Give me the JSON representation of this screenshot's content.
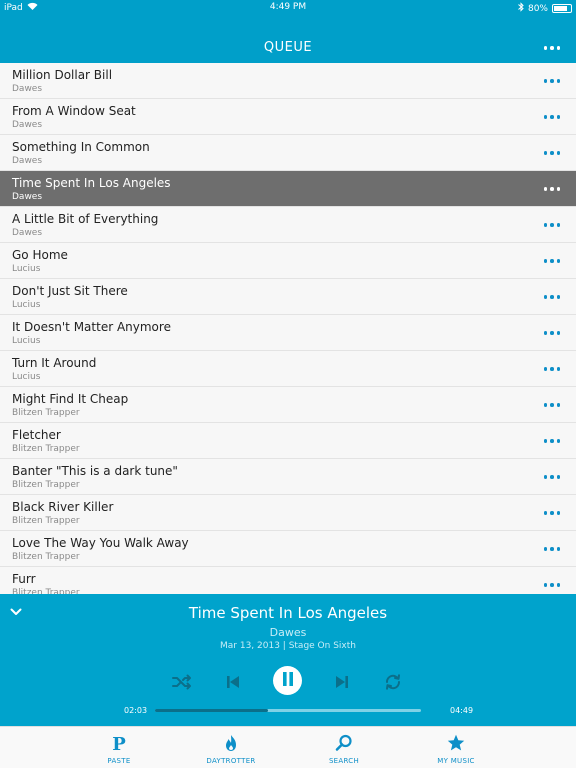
{
  "colors": {
    "accent": "#009fc9",
    "link": "#0e8fc8",
    "active_row": "#6e6e6e"
  },
  "status": {
    "device": "iPad",
    "time": "4:49 PM",
    "battery": "80%",
    "battery_level": 0.8
  },
  "header": {
    "title": "QUEUE"
  },
  "queue": [
    {
      "title": "Million Dollar Bill",
      "artist": "Dawes"
    },
    {
      "title": "From A Window Seat",
      "artist": "Dawes"
    },
    {
      "title": "Something In Common",
      "artist": "Dawes"
    },
    {
      "title": "Time Spent In Los Angeles",
      "artist": "Dawes",
      "active": true
    },
    {
      "title": "A Little Bit of Everything",
      "artist": "Dawes"
    },
    {
      "title": "Go Home",
      "artist": "Lucius"
    },
    {
      "title": "Don't Just Sit There",
      "artist": "Lucius"
    },
    {
      "title": "It Doesn't Matter Anymore",
      "artist": "Lucius"
    },
    {
      "title": "Turn It Around",
      "artist": "Lucius"
    },
    {
      "title": "Might Find It Cheap",
      "artist": "Blitzen Trapper"
    },
    {
      "title": "Fletcher",
      "artist": "Blitzen Trapper"
    },
    {
      "title": "Banter \"This is a dark tune\"",
      "artist": "Blitzen Trapper"
    },
    {
      "title": "Black River Killer",
      "artist": "Blitzen Trapper"
    },
    {
      "title": "Love The Way You Walk Away",
      "artist": "Blitzen Trapper"
    },
    {
      "title": "Furr",
      "artist": "Blitzen Trapper"
    }
  ],
  "now_playing": {
    "title": "Time Spent In Los Angeles",
    "artist": "Dawes",
    "meta": "Mar 13, 2013 | Stage On Sixth",
    "elapsed": "02:03",
    "duration": "04:49",
    "progress": 0.425
  },
  "controls": [
    "shuffle-icon",
    "previous-icon",
    "pause-icon",
    "next-icon",
    "repeat-icon"
  ],
  "tabs": [
    {
      "label": "PASTE",
      "icon": "paste-icon"
    },
    {
      "label": "DAYTROTTER",
      "icon": "daytrotter-icon"
    },
    {
      "label": "SEARCH",
      "icon": "search-icon"
    },
    {
      "label": "MY MUSIC",
      "icon": "star-icon"
    }
  ]
}
